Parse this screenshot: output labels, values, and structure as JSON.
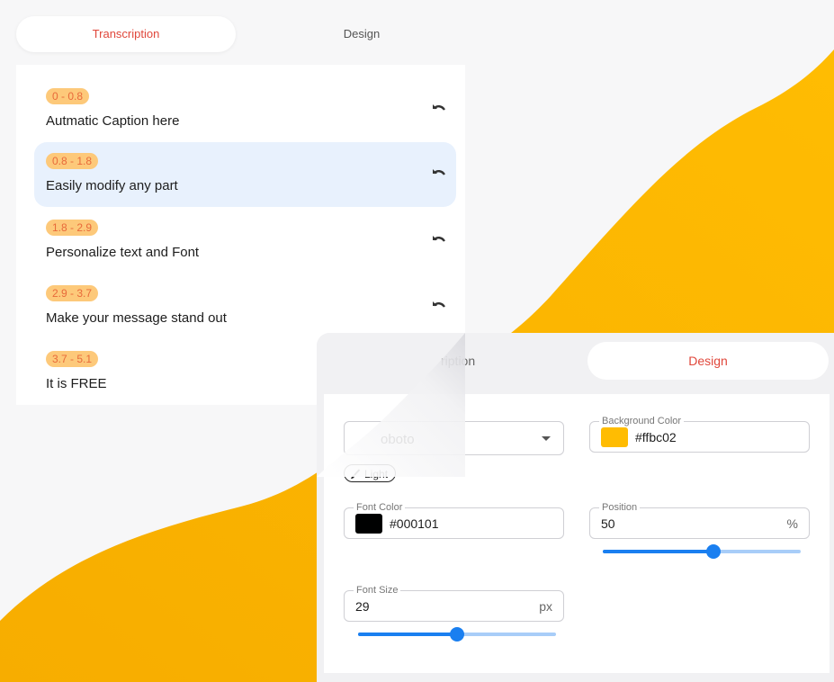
{
  "top_tabs": {
    "transcription": "Transcription",
    "design": "Design"
  },
  "captions": [
    {
      "time": "0 - 0.8",
      "text": "Autmatic Caption here",
      "selected": false
    },
    {
      "time": "0.8 - 1.8",
      "text": "Easily modify any part",
      "selected": true
    },
    {
      "time": "1.8 - 2.9",
      "text": "Personalize text and Font",
      "selected": false
    },
    {
      "time": "2.9 - 3.7",
      "text": "Make your message stand out",
      "selected": false
    },
    {
      "time": "3.7 - 5.1",
      "text": "It is FREE",
      "selected": false
    }
  ],
  "design_panel": {
    "tabs": {
      "transcription": "ription",
      "design": "Design"
    },
    "font": {
      "value": "oboto"
    },
    "theme_button": {
      "label": "Light",
      "icon": "brush-icon"
    },
    "background_color": {
      "label": "Background Color",
      "value": "#ffbc02",
      "swatch": "#ffbc02"
    },
    "font_color": {
      "label": "Font Color",
      "value": "#000101",
      "swatch": "#000101"
    },
    "position": {
      "label": "Position",
      "value": "50",
      "unit": "%",
      "slider_fraction": 0.56
    },
    "font_size": {
      "label": "Font Size",
      "value": "29",
      "unit": "px",
      "slider_fraction": 0.5
    }
  },
  "colors": {
    "accent": "#ffbc02",
    "tab_active_text": "#e0473b",
    "slider": "#1a7ff0",
    "badge_bg": "#fdc97a",
    "selected_row": "#e8f1fd"
  }
}
